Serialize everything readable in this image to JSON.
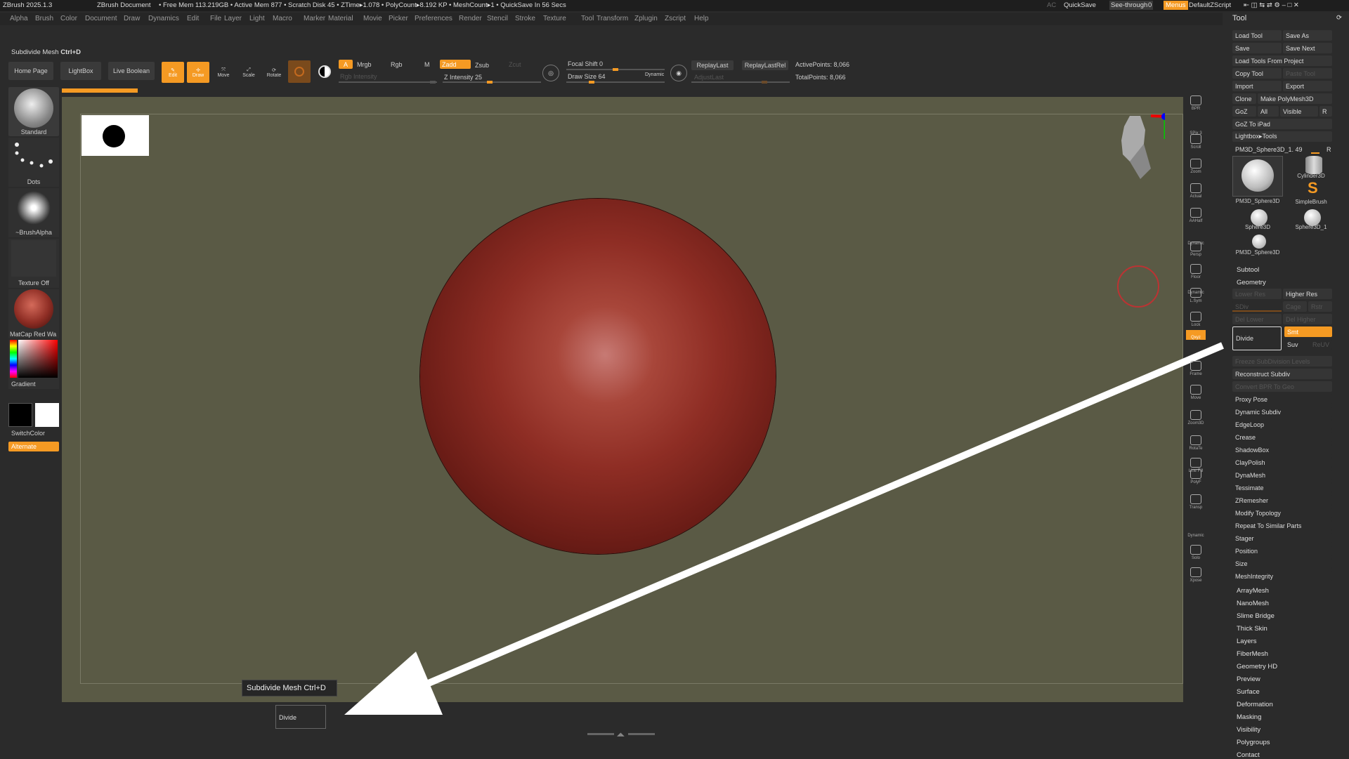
{
  "titlebar": {
    "app": "ZBrush 2025.1.3",
    "document": "ZBrush Document",
    "status": "• Free Mem 113.219GB • Active Mem 877 • Scratch Disk 45 • ZTime▸1.078 • PolyCount▸8.192 KP • MeshCount▸1 • QuickSave In 56 Secs",
    "ac": "AC",
    "quicksave": "QuickSave",
    "see_through": "See-through",
    "see_through_value": "0",
    "menus": "Menus",
    "script": "DefaultZScript"
  },
  "menubar": [
    "Alpha",
    "Brush",
    "Color",
    "Document",
    "Draw",
    "Dynamics",
    "Edit",
    "File",
    "Layer",
    "Light",
    "Macro",
    "Marker",
    "Material",
    "Movie",
    "Picker",
    "Preferences",
    "Render",
    "Stencil",
    "Stroke",
    "Texture",
    "Tool",
    "Transform",
    "Zplugin",
    "Zscript",
    "Help"
  ],
  "hint": {
    "label": "Subdivide Mesh",
    "shortcut": "Ctrl+D"
  },
  "top_toolbar": {
    "home_page": "Home Page",
    "lightbox": "LightBox",
    "live_boolean": "Live Boolean",
    "edit": "Edit",
    "draw": "Draw",
    "move": "Move",
    "scale": "Scale",
    "rotate": "Rotate",
    "a": "A",
    "mrgb": "Mrgb",
    "rgb": "Rgb",
    "m": "M",
    "zadd": "Zadd",
    "zsub": "Zsub",
    "zcut": "Zcut",
    "rgb_intensity": "Rgb Intensity",
    "z_intensity": "Z Intensity 25",
    "z_intensity_level": 0.25,
    "focal_shift": "Focal Shift 0",
    "draw_size": "Draw Size 64",
    "dynamic": "Dynamic",
    "replay_last": "ReplayLast",
    "replay_last_rel": "ReplayLastRel",
    "adjust_last": "AdjustLast",
    "active_points": "ActivePoints: 8,066",
    "total_points": "TotalPoints: 8,066"
  },
  "left_shelf": {
    "brush": "Standard",
    "stroke": "Dots",
    "alpha": "~BrushAlpha",
    "texture": "Texture Off",
    "material": "MatCap Red Wa",
    "gradient": "Gradient",
    "switch_color": "SwitchColor",
    "alternate": "Alternate"
  },
  "right_shelf": [
    "BPR",
    "SPix 3",
    "Scroll",
    "Zoom",
    "Actual",
    "AAHalf",
    "Dynamic",
    "Persp",
    "Floor",
    "Dynamic",
    "L.Sym",
    "Lock",
    "Qxyz",
    "Frame",
    "Move",
    "Zoom3D",
    "RotaTe",
    "Line Fill",
    "PolyF",
    "Transp",
    "Dynamic",
    "Solo",
    "Xpose"
  ],
  "tool_panel": {
    "title": "Tool",
    "load_tool": "Load Tool",
    "save_as": "Save As",
    "save": "Save",
    "save_next": "Save Next",
    "load_from_project": "Load Tools From Project",
    "copy_tool": "Copy Tool",
    "paste_tool": "Paste Tool",
    "import": "Import",
    "export": "Export",
    "clone": "Clone",
    "make_polymesh": "Make PolyMesh3D",
    "goz": "GoZ",
    "all": "All",
    "visible": "Visible",
    "r": "R",
    "goz_ipad": "GoZ To iPad",
    "lightbox_tools": "Lightbox▸Tools",
    "current_tool": "PM3D_Sphere3D_1. 49",
    "thumbs": [
      "PM3D_Sphere3D",
      "Cylinder3D",
      "SimpleBrush",
      "Sphere3D",
      "Sphere3D_1",
      "PM3D_Sphere3D"
    ],
    "subtool": "Subtool",
    "geometry": "Geometry",
    "lower_res": "Lower Res",
    "higher_res": "Higher Res",
    "sdiv": "SDiv",
    "cage": "Cage",
    "rstr": "Rstr",
    "del_lower": "Del Lower",
    "del_higher": "Del Higher",
    "divide": "Divide",
    "smt": "Smt",
    "suv": "Suv",
    "reuv": "ReUV",
    "geometry_items": [
      "Freeze SubDivision Levels",
      "Reconstruct Subdiv",
      "Convert BPR To Geo",
      "Proxy Pose",
      "Dynamic Subdiv",
      "EdgeLoop",
      "Crease",
      "ShadowBox",
      "ClayPolish",
      "DynaMesh",
      "Tessimate",
      "ZRemesher",
      "Modify Topology",
      "Repeat To Similar Parts",
      "Stager",
      "Position",
      "Size",
      "MeshIntegrity"
    ],
    "sections": [
      "ArrayMesh",
      "NanoMesh",
      "Slime Bridge",
      "Thick Skin",
      "Layers",
      "FiberMesh",
      "Geometry HD",
      "Preview",
      "Surface",
      "Deformation",
      "Masking",
      "Visibility",
      "Polygroups",
      "Contact"
    ]
  },
  "tooltip": {
    "label": "Subdivide Mesh",
    "shortcut": "Ctrl+D",
    "button": "Divide"
  },
  "colors": {
    "orange": "#f59a23",
    "canvas": "#5a5a45",
    "sphere": "#8e2d24"
  }
}
